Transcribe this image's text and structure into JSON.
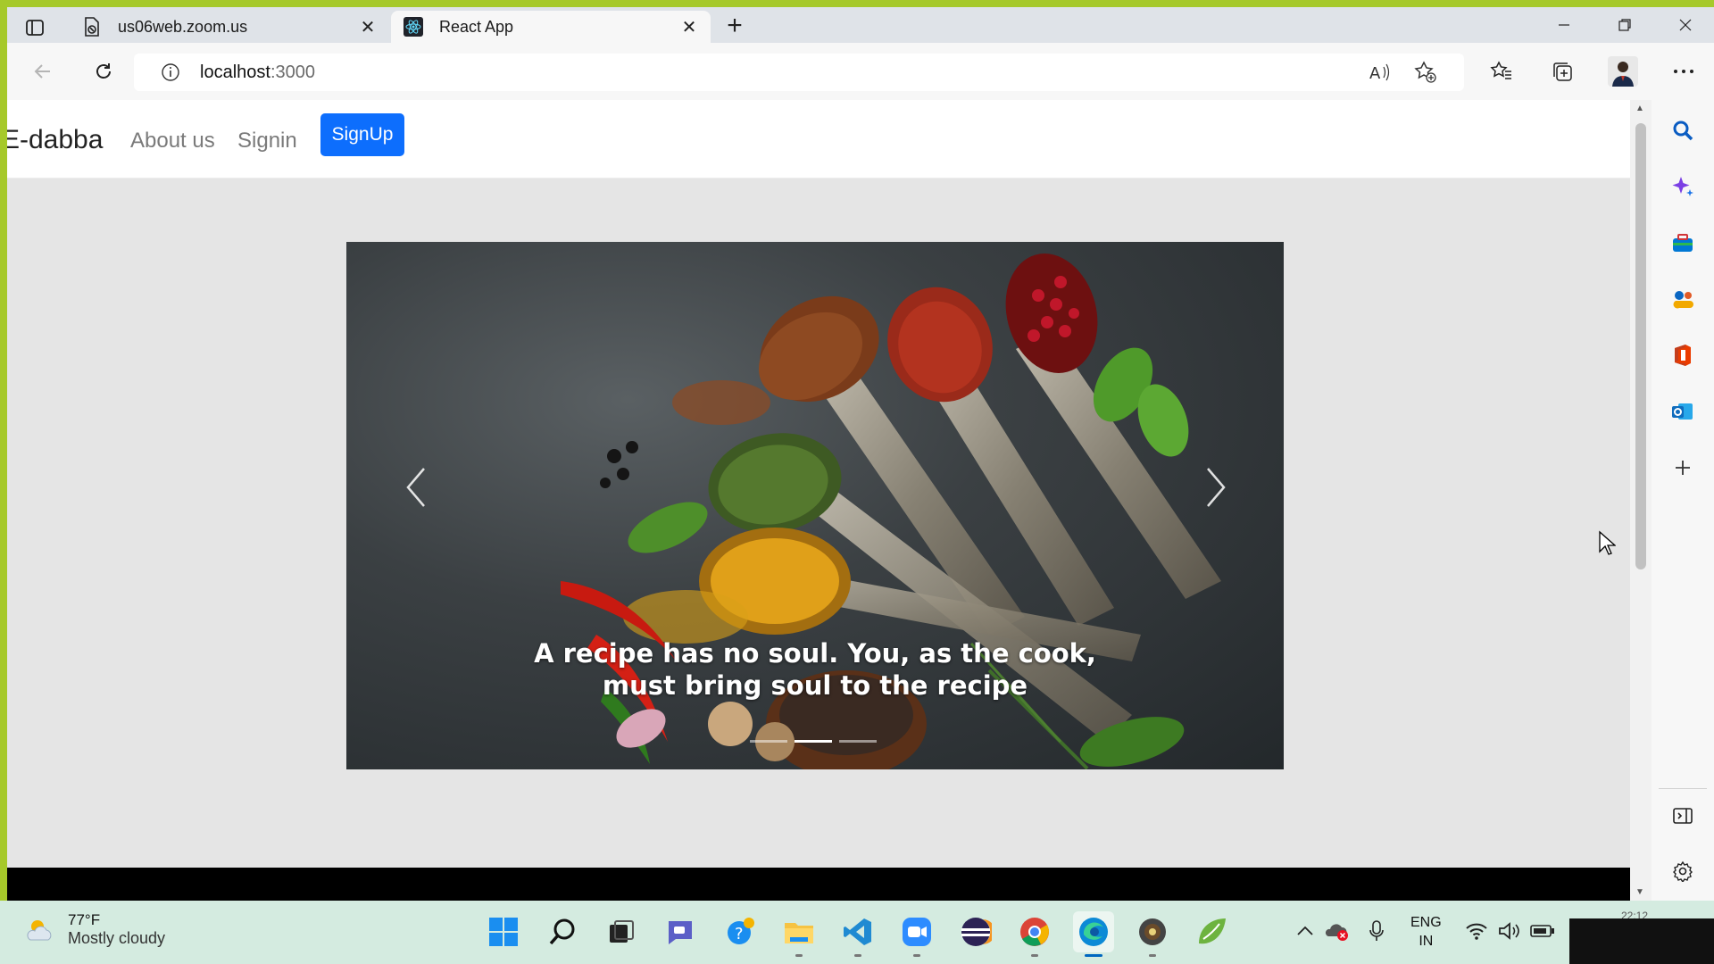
{
  "browser": {
    "tabs": [
      {
        "title": "us06web.zoom.us",
        "favicon": "document-icon",
        "active": false
      },
      {
        "title": "React App",
        "favicon": "react-icon",
        "active": true
      }
    ],
    "address": {
      "host": "localhost",
      "port": ":3000"
    }
  },
  "page": {
    "brand": "E-dabba",
    "nav": {
      "about": "About us",
      "signin": "Signin",
      "signup": "SignUp"
    },
    "carousel": {
      "caption": "A recipe has no soul. You, as the cook, must bring soul to the recipe",
      "slides": 3,
      "active_slide": 1
    }
  },
  "taskbar": {
    "weather": {
      "temp": "77°F",
      "desc": "Mostly cloudy"
    },
    "lang": {
      "line1": "ENG",
      "line2": "IN"
    },
    "clock_partial": "22:12"
  },
  "colors": {
    "signup_button": "#0d6efd",
    "desktop_border": "#a6c92a",
    "taskbar": "#d4ebe0"
  }
}
